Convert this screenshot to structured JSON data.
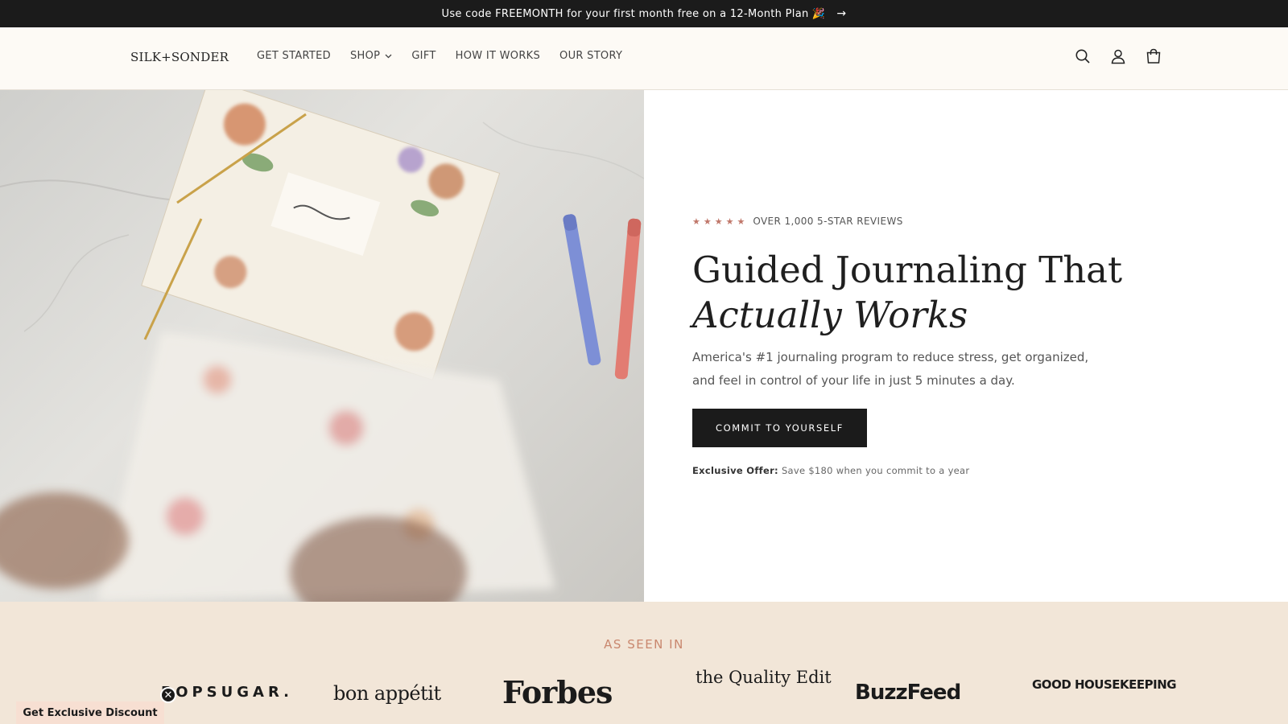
{
  "announcement": {
    "text": "Use code FREEMONTH for your first month free on a 12-Month Plan 🎉",
    "arrow": "→"
  },
  "header": {
    "logo": "SILK+SONDER",
    "nav": [
      {
        "label": "GET STARTED"
      },
      {
        "label": "SHOP",
        "has_dropdown": true
      },
      {
        "label": "GIFT"
      },
      {
        "label": "HOW IT WORKS"
      },
      {
        "label": "OUR STORY"
      }
    ],
    "icons": [
      "search-icon",
      "account-icon",
      "cart-icon"
    ]
  },
  "hero": {
    "stars": "★★★★★",
    "reviews": "OVER 1,000 5-STAR REVIEWS",
    "headline_line1": "Guided Journaling That",
    "headline_line2": "Actually Works",
    "subtext": "America's #1 journaling program to reduce stress, get organized, and feel in control of your life in just 5 minutes a day.",
    "cta": "COMMIT TO YOURSELF",
    "offer_label": "Exclusive Offer:",
    "offer_text": "Save $180 when you commit to a year"
  },
  "press": {
    "title": "AS SEEN IN",
    "logos": [
      "POPSUGAR.",
      "bon appétit",
      "Forbes",
      "the Quality Edit",
      "BuzzFeed",
      "GOOD HOUSEKEEPING"
    ]
  },
  "discount": {
    "label": "Get Exclusive Discount",
    "close": "✕"
  },
  "colors": {
    "announcement_bg": "#1b1b1b",
    "header_bg": "#fdfaf5",
    "star": "#c0776a",
    "press_bg": "#f2e6d8",
    "press_title": "#c9876e",
    "discount_bg": "#f7dfd2"
  }
}
